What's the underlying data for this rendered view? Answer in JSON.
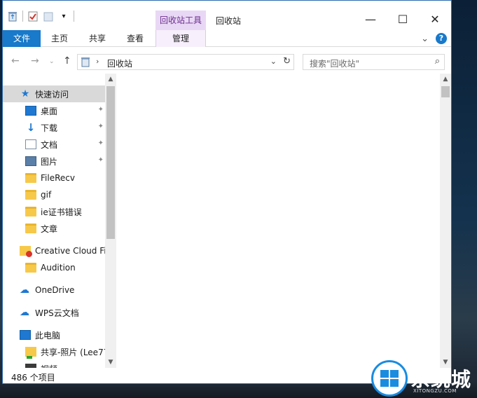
{
  "titlebar": {
    "tool_tab": "回收站工具",
    "window_title": "回收站",
    "minimize": "—",
    "maximize": "☐",
    "close": "✕"
  },
  "ribbon": {
    "tabs": [
      "文件",
      "主页",
      "共享",
      "查看",
      "管理"
    ],
    "expand_chevron": "⌄",
    "help": "?"
  },
  "address": {
    "path": "回收站",
    "search_placeholder": "搜索\"回收站\""
  },
  "nav": {
    "items": [
      {
        "label": "快速访问",
        "icon": "star-icon",
        "pinned": false,
        "selected": true
      },
      {
        "label": "桌面",
        "icon": "desktop-icon",
        "pinned": true
      },
      {
        "label": "下载",
        "icon": "download-icon",
        "pinned": true
      },
      {
        "label": "文档",
        "icon": "document-icon",
        "pinned": true
      },
      {
        "label": "图片",
        "icon": "pictures-icon",
        "pinned": true
      },
      {
        "label": "FileRecv",
        "icon": "folder-icon",
        "pinned": false
      },
      {
        "label": "gif",
        "icon": "folder-icon",
        "pinned": false
      },
      {
        "label": "ie证书错误",
        "icon": "folder-icon",
        "pinned": false
      },
      {
        "label": "文章",
        "icon": "folder-icon",
        "pinned": false
      },
      {
        "label": "Creative Cloud Fil",
        "icon": "creative-cloud-icon",
        "pinned": false
      },
      {
        "label": "Audition",
        "icon": "folder-icon",
        "pinned": false
      },
      {
        "label": "OneDrive",
        "icon": "onedrive-icon",
        "pinned": false
      },
      {
        "label": "WPS云文档",
        "icon": "wps-cloud-icon",
        "pinned": false
      },
      {
        "label": "此电脑",
        "icon": "computer-icon",
        "pinned": false
      },
      {
        "label": "共享-照片 (Lee77",
        "icon": "shared-folder-icon",
        "pinned": false
      },
      {
        "label": "视频",
        "icon": "video-icon",
        "pinned": false
      }
    ]
  },
  "status": {
    "item_count": "486 个项目"
  },
  "watermark": {
    "text": "系统城",
    "sub": "XITONGZU.COM"
  },
  "colors": {
    "accent": "#1979ca",
    "tool_tab_bg": "#e9d8f5",
    "tool_tab_text": "#6b2e8f"
  }
}
